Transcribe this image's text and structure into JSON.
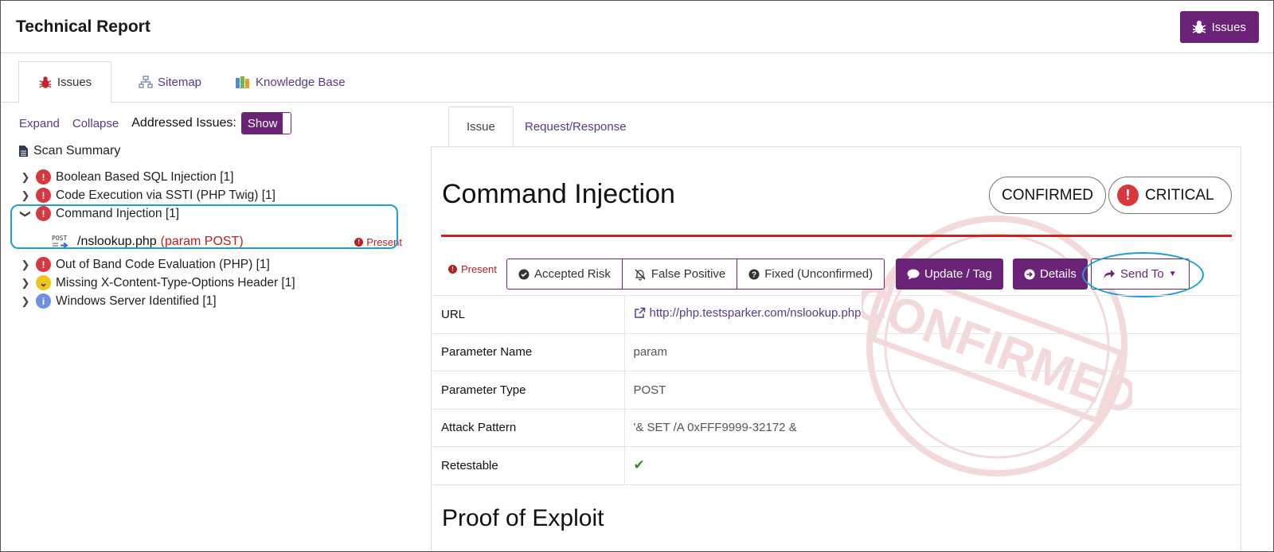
{
  "header": {
    "title": "Technical Report",
    "issues_button": "Issues"
  },
  "top_tabs": [
    {
      "label": "Issues",
      "icon": "bug-icon"
    },
    {
      "label": "Sitemap",
      "icon": "sitemap-icon"
    },
    {
      "label": "Knowledge Base",
      "icon": "books-icon"
    }
  ],
  "left": {
    "expand": "Expand",
    "collapse": "Collapse",
    "addressed_label": "Addressed Issues:",
    "toggle_label": "Show",
    "scan_summary": "Scan Summary",
    "tree": [
      {
        "label": "Boolean Based SQL Injection [1]",
        "severity": "critical",
        "expanded": false
      },
      {
        "label": "Code Execution via SSTI (PHP Twig) [1]",
        "severity": "critical",
        "expanded": false
      },
      {
        "label": "Command Injection [1]",
        "severity": "critical",
        "expanded": true
      },
      {
        "label": "Out of Band Code Evaluation (PHP) [1]",
        "severity": "critical",
        "expanded": false
      },
      {
        "label": "Missing X-Content-Type-Options Header [1]",
        "severity": "low",
        "expanded": false
      },
      {
        "label": "Windows Server Identified [1]",
        "severity": "info",
        "expanded": false
      }
    ],
    "sub_item": {
      "icon_text": "POST",
      "path": "/nslookup.php",
      "param": "(param POST)",
      "status": "Present"
    }
  },
  "right": {
    "tabs": [
      "Issue",
      "Request/Response"
    ],
    "issue_title": "Command Injection",
    "confirmed": "CONFIRMED",
    "critical": "CRITICAL",
    "status": "Present",
    "actions": {
      "accepted_risk": "Accepted Risk",
      "false_positive": "False Positive",
      "fixed": "Fixed (Unconfirmed)",
      "update_tag": "Update / Tag",
      "details": "Details",
      "send_to": "Send To"
    },
    "details": [
      {
        "key": "URL",
        "value": "http://php.testsparker.com/nslookup.php"
      },
      {
        "key": "Parameter Name",
        "value": "param"
      },
      {
        "key": "Parameter Type",
        "value": "POST"
      },
      {
        "key": "Attack Pattern",
        "value": "'& SET /A 0xFFF9999-32172 &"
      },
      {
        "key": "Retestable",
        "value": "✔"
      }
    ],
    "proof_title": "Proof of Exploit",
    "stamp_text": "CONFIRMED"
  },
  "colors": {
    "brand": "#6b2378",
    "critical": "#d9363e",
    "highlight": "#1aa0e0",
    "link": "#5a3a8a"
  }
}
